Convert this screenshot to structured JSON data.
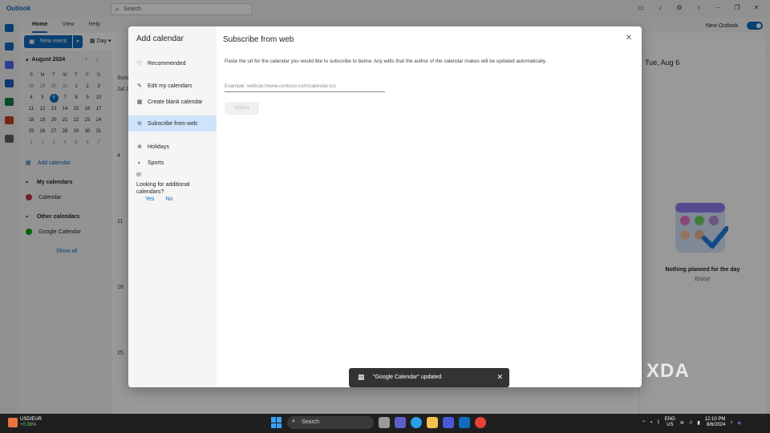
{
  "app": {
    "name": "Outlook",
    "search_placeholder": "Search",
    "ribbon_tabs": [
      {
        "label": "Home",
        "active": true
      },
      {
        "label": "View",
        "active": false
      },
      {
        "label": "Help",
        "active": false
      }
    ],
    "new_outlook_label": "New Outlook",
    "new_outlook_enabled": true,
    "new_event_label": "New event",
    "day_view_label": "Day"
  },
  "mini_calendar": {
    "month_label": "August 2024",
    "weekdays": [
      "S",
      "M",
      "T",
      "W",
      "T",
      "F",
      "S"
    ],
    "weeks": [
      [
        "28",
        "29",
        "30",
        "31",
        "1",
        "2",
        "3"
      ],
      [
        "4",
        "5",
        "6",
        "7",
        "8",
        "9",
        "10"
      ],
      [
        "11",
        "12",
        "13",
        "14",
        "15",
        "16",
        "17"
      ],
      [
        "18",
        "19",
        "20",
        "21",
        "22",
        "23",
        "24"
      ],
      [
        "25",
        "26",
        "27",
        "28",
        "29",
        "30",
        "31"
      ],
      [
        "1",
        "2",
        "3",
        "4",
        "5",
        "6",
        "7"
      ]
    ],
    "today": "6"
  },
  "left_pane": {
    "add_calendar": "Add calendar",
    "my_calendars_header": "My calendars",
    "my_calendars": [
      {
        "label": "Calendar",
        "color": "#c4314b"
      }
    ],
    "other_calendars_header": "Other calendars",
    "other_calendars": [
      {
        "label": "Google Calendar",
        "color": "#13a10e"
      }
    ],
    "show_all": "Show all"
  },
  "grid": {
    "header_fragments": [
      "Sund",
      "Jul 2"
    ],
    "week_starts": [
      "4",
      "11",
      "18",
      "25"
    ]
  },
  "right_pane": {
    "date_label": "Tue, Aug 6",
    "empty_title": "Nothing planned for the day",
    "empty_subtitle": "Enjoy!"
  },
  "dialog": {
    "sidebar_title": "Add calendar",
    "sidebar_items": [
      {
        "label": "Recommended",
        "icon": "lightbulb-icon",
        "glyph": "♡",
        "active": false
      },
      {
        "label": "Edit my calendars",
        "icon": "edit-icon",
        "glyph": "✎",
        "active": false
      },
      {
        "label": "Create blank calendar",
        "icon": "calendar-add-icon",
        "glyph": "▦",
        "active": false
      },
      {
        "label": "Subscribe from web",
        "icon": "globe-link-icon",
        "glyph": "⊖",
        "active": true
      },
      {
        "label": "Holidays",
        "icon": "globe-icon",
        "glyph": "⊕",
        "active": false
      },
      {
        "label": "Sports",
        "icon": "sports-icon",
        "glyph": "◐",
        "active": false
      }
    ],
    "looking_text": "Looking for additional calendars?",
    "feedback_yes": "Yes",
    "feedback_no": "No",
    "title": "Subscribe from web",
    "description": "Paste the url for the calendar you would like to subscribe to below. Any edits that the author of the calendar makes will be updated automatically.",
    "url_placeholder": "Example: webcal://www.contoso.com/calendar.ics",
    "url_value": "",
    "import_label": "Import"
  },
  "toast": {
    "message": "\"Google Calendar\" updated."
  },
  "watermark": "XDA",
  "taskbar": {
    "ticker_pair": "USD/EUR",
    "ticker_change": "+0.36%",
    "search_placeholder": "Search",
    "lang_primary": "ENG",
    "lang_secondary": "US",
    "time": "12:10 PM",
    "date": "8/6/2024"
  },
  "colors": {
    "accent": "#0f6cbd",
    "selected_nav": "#cfe4fa"
  }
}
